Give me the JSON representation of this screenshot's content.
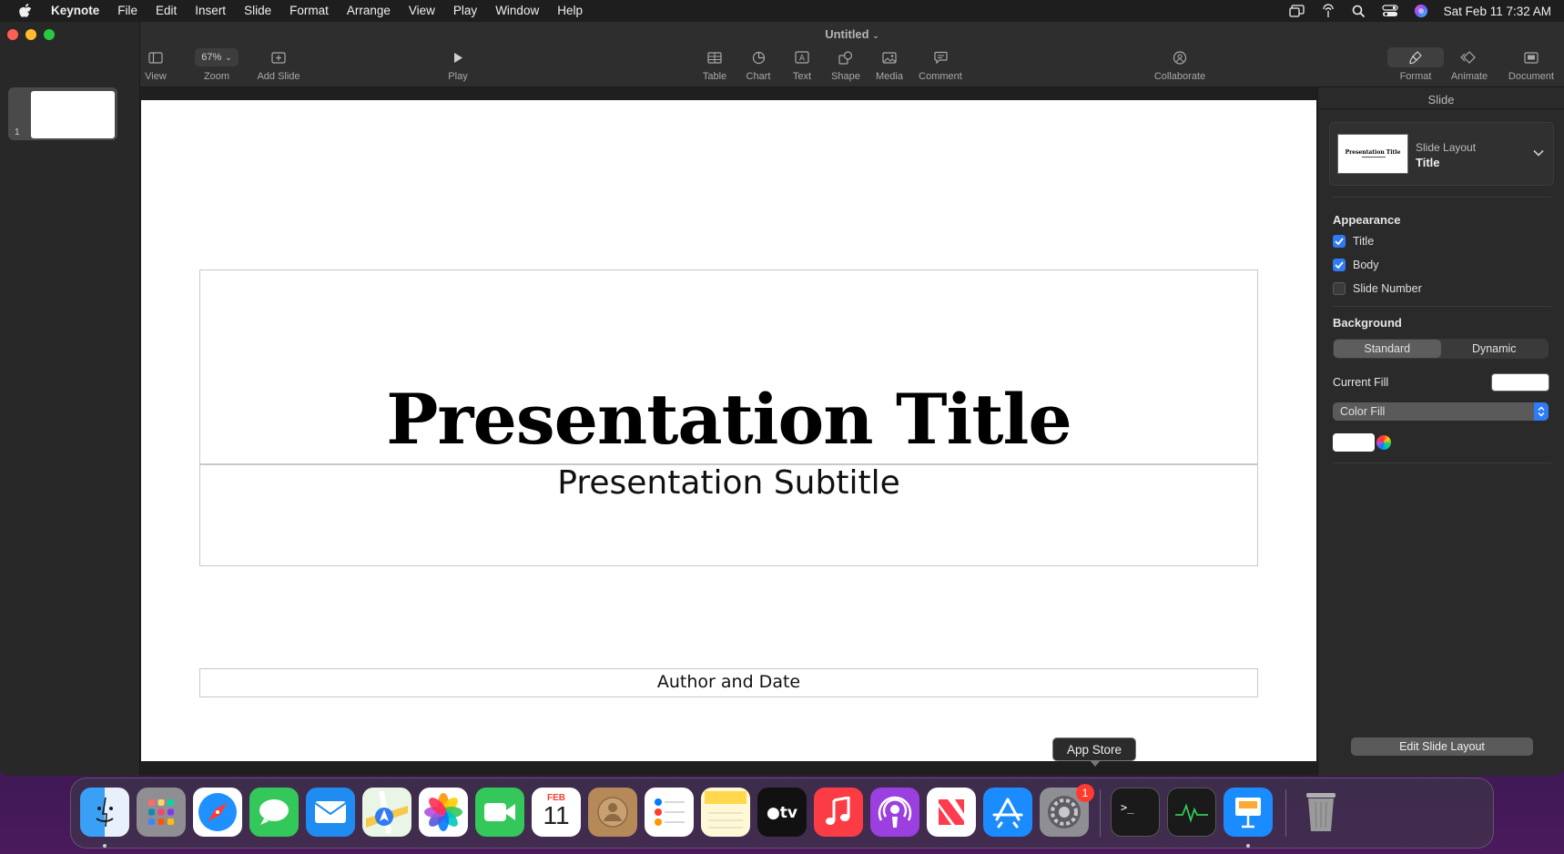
{
  "menubar": {
    "app_name": "Keynote",
    "items": [
      "File",
      "Edit",
      "Insert",
      "Slide",
      "Format",
      "Arrange",
      "View",
      "Play",
      "Window",
      "Help"
    ],
    "clock": "Sat Feb 11  7:32 AM"
  },
  "window": {
    "title": "Untitled",
    "toolbar": {
      "view": "View",
      "zoom": "Zoom",
      "zoom_value": "67%",
      "add_slide": "Add Slide",
      "play": "Play",
      "table": "Table",
      "chart": "Chart",
      "text": "Text",
      "shape": "Shape",
      "media": "Media",
      "comment": "Comment",
      "collaborate": "Collaborate",
      "format": "Format",
      "animate": "Animate",
      "document": "Document"
    }
  },
  "navigator": {
    "slide_number": "1"
  },
  "slide": {
    "title": "Presentation Title",
    "subtitle": "Presentation Subtitle",
    "author": "Author and Date"
  },
  "inspector": {
    "header": "Slide",
    "layout_label": "Slide Layout",
    "layout_value": "Title",
    "layout_thumb_title": "Presentation Title",
    "appearance_title": "Appearance",
    "appearance": [
      {
        "label": "Title",
        "checked": true
      },
      {
        "label": "Body",
        "checked": true
      },
      {
        "label": "Slide Number",
        "checked": false
      }
    ],
    "background_title": "Background",
    "background_options": [
      "Standard",
      "Dynamic"
    ],
    "background_selected": "Standard",
    "current_fill_label": "Current Fill",
    "fill_type": "Color Fill",
    "edit_layout_button": "Edit Slide Layout"
  },
  "tooltip": "App Store",
  "dock": {
    "calendar_month": "FEB",
    "calendar_day": "11",
    "settings_badge": "1",
    "apps": [
      "Finder",
      "Launchpad",
      "Safari",
      "Messages",
      "Mail",
      "Maps",
      "Photos",
      "FaceTime",
      "Calendar",
      "Contacts",
      "Reminders",
      "Notes",
      "TV",
      "Music",
      "Podcasts",
      "News",
      "App Store",
      "System Settings",
      "Terminal",
      "Activity Monitor",
      "Keynote",
      "Trash"
    ]
  },
  "colors": {
    "accent": "#2f7bf6",
    "menubar_bg": "#1e1e1e",
    "window_bg": "#2b2b2b",
    "slide_bg": "#ffffff"
  }
}
